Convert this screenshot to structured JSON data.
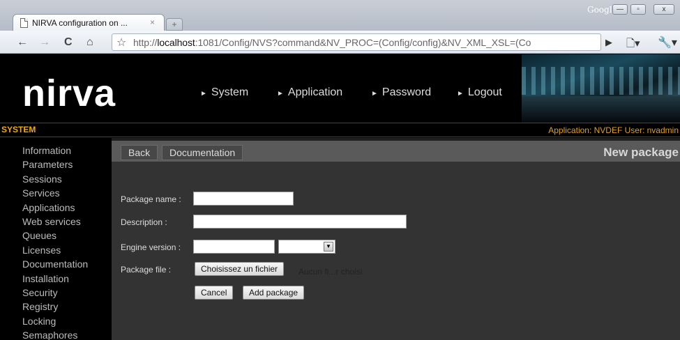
{
  "browser": {
    "tab_title": "NIRVA configuration on ...",
    "tab_close": "×",
    "new_tab": "+",
    "google_label": "Google",
    "window_controls": {
      "minimize": "—",
      "maximize": "▫",
      "close": "x"
    },
    "nav": {
      "back": "←",
      "forward": "→",
      "reload": "C",
      "home": "⌂"
    },
    "url_prefix": "http://",
    "url_host": "localhost",
    "url_rest": ":1081/Config/NVS?command&NV_PROC=(Config/config)&NV_XML_XSL=(Co",
    "icons": {
      "star": "☆",
      "play": "▶",
      "page": "🗋▾",
      "wrench": "🔧▾"
    }
  },
  "header": {
    "logo": "nirva",
    "nav_items": [
      {
        "label": "System"
      },
      {
        "label": "Application"
      },
      {
        "label": "Password"
      },
      {
        "label": "Logout"
      }
    ],
    "nav_marker": "►"
  },
  "status_bar": {
    "section": "SYSTEM",
    "application_info": "Application: NVDEF  User: nvadmin"
  },
  "sidebar": {
    "items": [
      {
        "label": "Information"
      },
      {
        "label": "Parameters"
      },
      {
        "label": "Sessions"
      },
      {
        "label": "Services"
      },
      {
        "label": "Applications"
      },
      {
        "label": "Web services"
      },
      {
        "label": "Queues"
      },
      {
        "label": "Licenses"
      },
      {
        "label": "Documentation"
      },
      {
        "label": "Installation"
      },
      {
        "label": "Security"
      },
      {
        "label": "Registry"
      },
      {
        "label": "Locking"
      },
      {
        "label": "Semaphores"
      }
    ]
  },
  "main": {
    "actions": {
      "back": "Back",
      "documentation": "Documentation"
    },
    "title": "New package",
    "form": {
      "package_name_label": "Package name :",
      "package_name_value": "",
      "description_label": "Description :",
      "description_value": "",
      "engine_version_label": "Engine version :",
      "engine_version_value": "",
      "engine_select_value": "",
      "engine_select_arrow": "▼",
      "package_file_label": "Package file :",
      "choose_file_button": "Choisissez un fichier",
      "no_file_text": "Aucun fi...r choisi",
      "cancel_button": "Cancel",
      "add_button": "Add package"
    }
  },
  "colors": {
    "accent": "#f2a900",
    "header_bg": "#000000",
    "content_bg": "#333333",
    "action_bar_bg": "#5a5a5a"
  }
}
